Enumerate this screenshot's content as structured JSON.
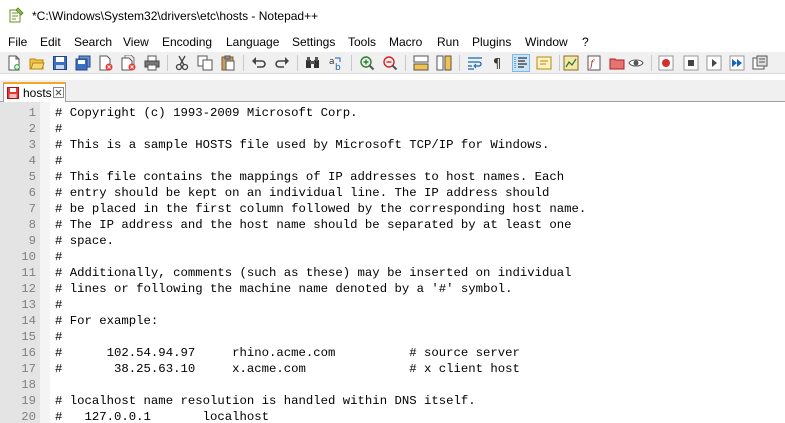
{
  "window": {
    "title": "*C:\\Windows\\System32\\drivers\\etc\\hosts - Notepad++",
    "app_icon": "notepad-plus-plus-icon"
  },
  "menu": [
    "File",
    "Edit",
    "Search",
    "View",
    "Encoding",
    "Language",
    "Settings",
    "Tools",
    "Macro",
    "Run",
    "Plugins",
    "Window",
    "?"
  ],
  "toolbar": {
    "icons": [
      "new-file-icon",
      "open-file-icon",
      "save-icon",
      "save-all-icon",
      "close-icon",
      "close-all-icon",
      "print-icon",
      "cut-icon",
      "copy-icon",
      "paste-icon",
      "undo-icon",
      "redo-icon",
      "find-icon",
      "replace-icon",
      "zoom-in-icon",
      "zoom-out-icon",
      "sync-vertical-icon",
      "sync-horizontal-icon",
      "word-wrap-icon",
      "show-all-characters-icon",
      "indent-guide-icon",
      "user-defined-language-icon",
      "document-map-icon",
      "function-list-icon",
      "folder-as-workspace-icon",
      "monitoring-icon",
      "record-macro-icon",
      "stop-recording-icon",
      "play-macro-icon",
      "run-macro-multiple-icon",
      "save-macro-icon"
    ]
  },
  "tabs": [
    {
      "label": "hosts",
      "icon": "unsaved-file-icon",
      "close_icon": "close-tab-icon",
      "active": true
    }
  ],
  "editor": {
    "lines": [
      {
        "num": "1",
        "text": "# Copyright (c) 1993-2009 Microsoft Corp."
      },
      {
        "num": "2",
        "text": "#"
      },
      {
        "num": "3",
        "text": "# This is a sample HOSTS file used by Microsoft TCP/IP for Windows."
      },
      {
        "num": "4",
        "text": "#"
      },
      {
        "num": "5",
        "text": "# This file contains the mappings of IP addresses to host names. Each"
      },
      {
        "num": "6",
        "text": "# entry should be kept on an individual line. The IP address should"
      },
      {
        "num": "7",
        "text": "# be placed in the first column followed by the corresponding host name."
      },
      {
        "num": "8",
        "text": "# The IP address and the host name should be separated by at least one"
      },
      {
        "num": "9",
        "text": "# space."
      },
      {
        "num": "10",
        "text": "#"
      },
      {
        "num": "11",
        "text": "# Additionally, comments (such as these) may be inserted on individual"
      },
      {
        "num": "12",
        "text": "# lines or following the machine name denoted by a '#' symbol."
      },
      {
        "num": "13",
        "text": "#"
      },
      {
        "num": "14",
        "text": "# For example:"
      },
      {
        "num": "15",
        "text": "#"
      },
      {
        "num": "16",
        "text": "#      102.54.94.97     rhino.acme.com          # source server"
      },
      {
        "num": "17",
        "text": "#       38.25.63.10     x.acme.com              # x client host"
      },
      {
        "num": "18",
        "text": ""
      },
      {
        "num": "19",
        "text": "# localhost name resolution is handled within DNS itself."
      },
      {
        "num": "20",
        "text": "#   127.0.0.1       localhost"
      }
    ]
  }
}
